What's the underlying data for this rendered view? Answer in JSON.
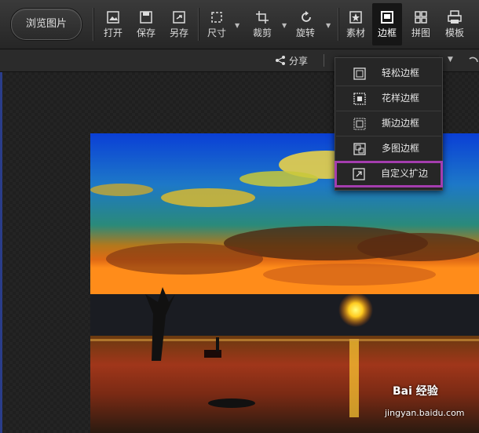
{
  "toolbar": {
    "browse_label": "浏览图片",
    "items": [
      {
        "label": "打开"
      },
      {
        "label": "保存"
      },
      {
        "label": "另存"
      },
      {
        "label": "尺寸"
      },
      {
        "label": "裁剪"
      },
      {
        "label": "旋转"
      },
      {
        "label": "素材"
      },
      {
        "label": "边框"
      },
      {
        "label": "拼图"
      },
      {
        "label": "模板"
      }
    ]
  },
  "subbar": {
    "share_label": "分享"
  },
  "border_menu": {
    "items": [
      {
        "label": "轻松边框",
        "icon": "simple-border-icon"
      },
      {
        "label": "花样边框",
        "icon": "pattern-border-icon"
      },
      {
        "label": "撕边边框",
        "icon": "torn-border-icon"
      },
      {
        "label": "多图边框",
        "icon": "multi-image-border-icon"
      },
      {
        "label": "自定义扩边",
        "icon": "custom-expand-icon"
      }
    ],
    "highlight_color": "#a43dae"
  },
  "watermark": {
    "logo": "Bai 经验",
    "url": "jingyan.baidu.com"
  }
}
